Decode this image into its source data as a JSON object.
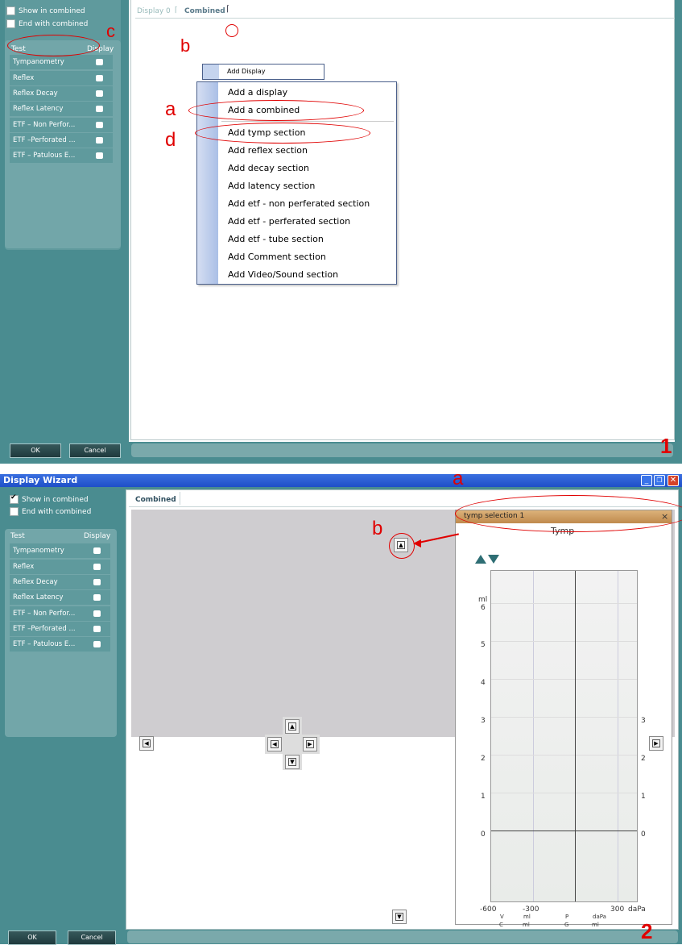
{
  "shot1": {
    "options": {
      "show_in_combined": "Show in combined",
      "end_with_combined": "End with combined"
    },
    "test_header": {
      "test": "Test",
      "display": "Display"
    },
    "tests": [
      "Tympanometry",
      "Reflex",
      "Reflex Decay",
      "Reflex Latency",
      "ETF – Non Perfor...",
      "ETF –Perforated ...",
      "ETF – Patulous E..."
    ],
    "tabs": {
      "display0": "Display 0",
      "combined": "Combined"
    },
    "submenu_title": "Add Display",
    "menu_items": [
      "Add a display",
      "Add a combined",
      "Add tymp section",
      "Add reflex section",
      "Add decay section",
      "Add latency section",
      "Add etf - non perferated section",
      "Add etf - perferated section",
      "Add etf - tube section",
      "Add Comment section",
      "Add Video/Sound section"
    ],
    "ok": "OK",
    "cancel": "Cancel",
    "annotations": {
      "a": "a",
      "b": "b",
      "c": "c",
      "d": "d",
      "num": "1"
    }
  },
  "shot2": {
    "window_title": "Display Wizard",
    "options": {
      "show_in_combined": "Show in combined",
      "end_with_combined": "End with combined"
    },
    "test_header": {
      "test": "Test",
      "display": "Display"
    },
    "tests": [
      "Tympanometry",
      "Reflex",
      "Reflex Decay",
      "Reflex Latency",
      "ETF – Non Perfor...",
      "ETF –Perforated ...",
      "ETF – Patulous E..."
    ],
    "tab_combined": "Combined",
    "tymp_panel_title": "tymp selection 1",
    "tymp_close": "×",
    "chart_title": "Tymp",
    "y_unit": "ml",
    "x_unit": "daPa",
    "y_ticks": [
      "6",
      "5",
      "4",
      "3",
      "2",
      "1",
      "0"
    ],
    "y_ticks_right": [
      "3",
      "2",
      "1",
      "0"
    ],
    "x_ticks": [
      "-600",
      "-300",
      "300"
    ],
    "legend": {
      "v": "V",
      "ml1": "ml",
      "p": "P",
      "dapa": "daPa",
      "c": "C",
      "ml2": "ml",
      "g": "G",
      "ml3": "ml"
    },
    "ok": "OK",
    "cancel": "Cancel",
    "annotations": {
      "a": "a",
      "b": "b",
      "num": "2"
    }
  },
  "colors": {
    "teal": "#4a8c90",
    "title_blue": "#2b5ed8",
    "annotation_red": "#e00000",
    "tymp_header": "#c99a5c"
  }
}
